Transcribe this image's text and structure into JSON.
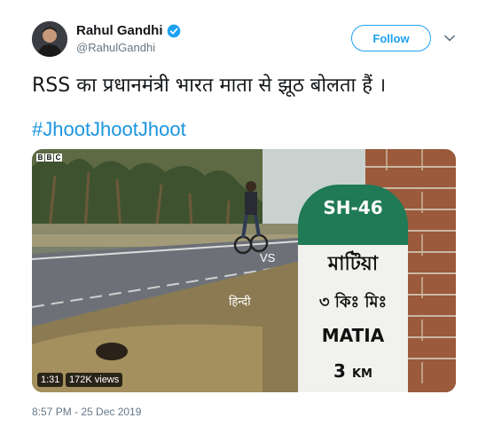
{
  "author": {
    "display_name": "Rahul Gandhi",
    "handle": "@RahulGandhi",
    "verified": true,
    "avatar_icon": "profile-photo"
  },
  "follow_button": {
    "label": "Follow"
  },
  "more_icon": "chevron-down-icon",
  "tweet": {
    "text": "RSS का प्रधानमंत्री भारत माता से झूठ बोलता हैं ।",
    "hashtag": "#JhootJhootJhoot"
  },
  "media": {
    "watermark": [
      "B",
      "B",
      "C"
    ],
    "overlay_vs": "VS",
    "overlay_hindi": "हिन्दी",
    "milestone": {
      "route": "SH-46",
      "bengali_name": "মাটিয়া",
      "bengali_distance": "৩ কিঃ মিঃ",
      "place": "MATIA",
      "distance_number": "3",
      "distance_unit": "KM"
    },
    "duration": "1:31",
    "views": "172K views"
  },
  "timestamp": "8:57 PM - 25 Dec 2019",
  "colors": {
    "accent": "#1da1f2",
    "hashtag": "#1b95e0",
    "milestone_green": "#1f7a55",
    "muted": "#657786"
  }
}
